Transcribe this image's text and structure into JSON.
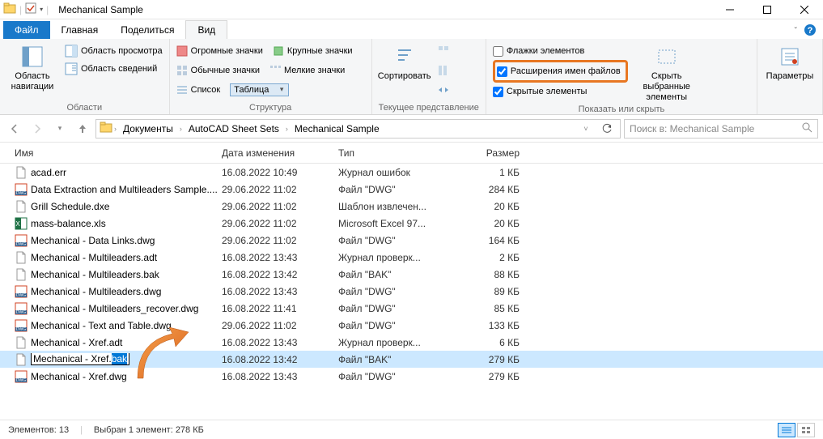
{
  "title": "Mechanical Sample",
  "menu": {
    "file": "Файл",
    "home": "Главная",
    "share": "Поделиться",
    "view": "Вид"
  },
  "ribbon": {
    "nav": {
      "big": "Область навигации",
      "preview": "Область просмотра",
      "details": "Область сведений",
      "label": "Области"
    },
    "layout": {
      "huge": "Огромные значки",
      "large": "Крупные значки",
      "normal": "Обычные значки",
      "small": "Мелкие значки",
      "list": "Список",
      "table": "Таблица",
      "label": "Структура"
    },
    "current": {
      "sort": "Сортировать",
      "label": "Текущее представление"
    },
    "show": {
      "flags": "Флажки элементов",
      "ext": "Расширения имен файлов",
      "hidden": "Скрытые элементы",
      "hide_sel": "Скрыть выбранные элементы",
      "label": "Показать или скрыть"
    },
    "options": {
      "btn": "Параметры"
    }
  },
  "breadcrumb": [
    "Документы",
    "AutoCAD Sheet Sets",
    "Mechanical Sample"
  ],
  "search_placeholder": "Поиск в: Mechanical Sample",
  "columns": {
    "name": "Имя",
    "date": "Дата изменения",
    "type": "Тип",
    "size": "Размер"
  },
  "files": [
    {
      "icon": "err",
      "name": "acad.err",
      "date": "16.08.2022 10:49",
      "type": "Журнал ошибок",
      "size": "1 КБ"
    },
    {
      "icon": "dwg",
      "name": "Data Extraction and Multileaders Sample....",
      "date": "29.06.2022 11:02",
      "type": "Файл \"DWG\"",
      "size": "284 КБ"
    },
    {
      "icon": "dxe",
      "name": "Grill Schedule.dxe",
      "date": "29.06.2022 11:02",
      "type": "Шаблон извлечен...",
      "size": "20 КБ"
    },
    {
      "icon": "xls",
      "name": "mass-balance.xls",
      "date": "29.06.2022 11:02",
      "type": "Microsoft Excel 97...",
      "size": "20 КБ"
    },
    {
      "icon": "dwg",
      "name": "Mechanical - Data Links.dwg",
      "date": "29.06.2022 11:02",
      "type": "Файл \"DWG\"",
      "size": "164 КБ"
    },
    {
      "icon": "adt",
      "name": "Mechanical - Multileaders.adt",
      "date": "16.08.2022 13:43",
      "type": "Журнал проверк...",
      "size": "2 КБ"
    },
    {
      "icon": "bak",
      "name": "Mechanical - Multileaders.bak",
      "date": "16.08.2022 13:42",
      "type": "Файл \"BAK\"",
      "size": "88 КБ"
    },
    {
      "icon": "dwg",
      "name": "Mechanical - Multileaders.dwg",
      "date": "16.08.2022 13:43",
      "type": "Файл \"DWG\"",
      "size": "89 КБ"
    },
    {
      "icon": "dwg",
      "name": "Mechanical - Multileaders_recover.dwg",
      "date": "16.08.2022 11:41",
      "type": "Файл \"DWG\"",
      "size": "85 КБ"
    },
    {
      "icon": "dwg",
      "name": "Mechanical - Text and Table.dwg",
      "date": "29.06.2022 11:02",
      "type": "Файл \"DWG\"",
      "size": "133 КБ"
    },
    {
      "icon": "adt",
      "name": "Mechanical - Xref.adt",
      "date": "16.08.2022 13:43",
      "type": "Журнал проверк...",
      "size": "6 КБ"
    },
    {
      "icon": "bak",
      "name": "Mechanical - Xref.bak",
      "date": "16.08.2022 13:42",
      "type": "Файл \"BAK\"",
      "size": "279 КБ",
      "rename": true,
      "prefix": "Mechanical - Xref.",
      "sel": "bak"
    },
    {
      "icon": "dwg",
      "name": "Mechanical - Xref.dwg",
      "date": "16.08.2022 13:43",
      "type": "Файл \"DWG\"",
      "size": "279 КБ"
    }
  ],
  "status": {
    "count": "Элементов: 13",
    "sel": "Выбран 1 элемент: 278 КБ"
  }
}
